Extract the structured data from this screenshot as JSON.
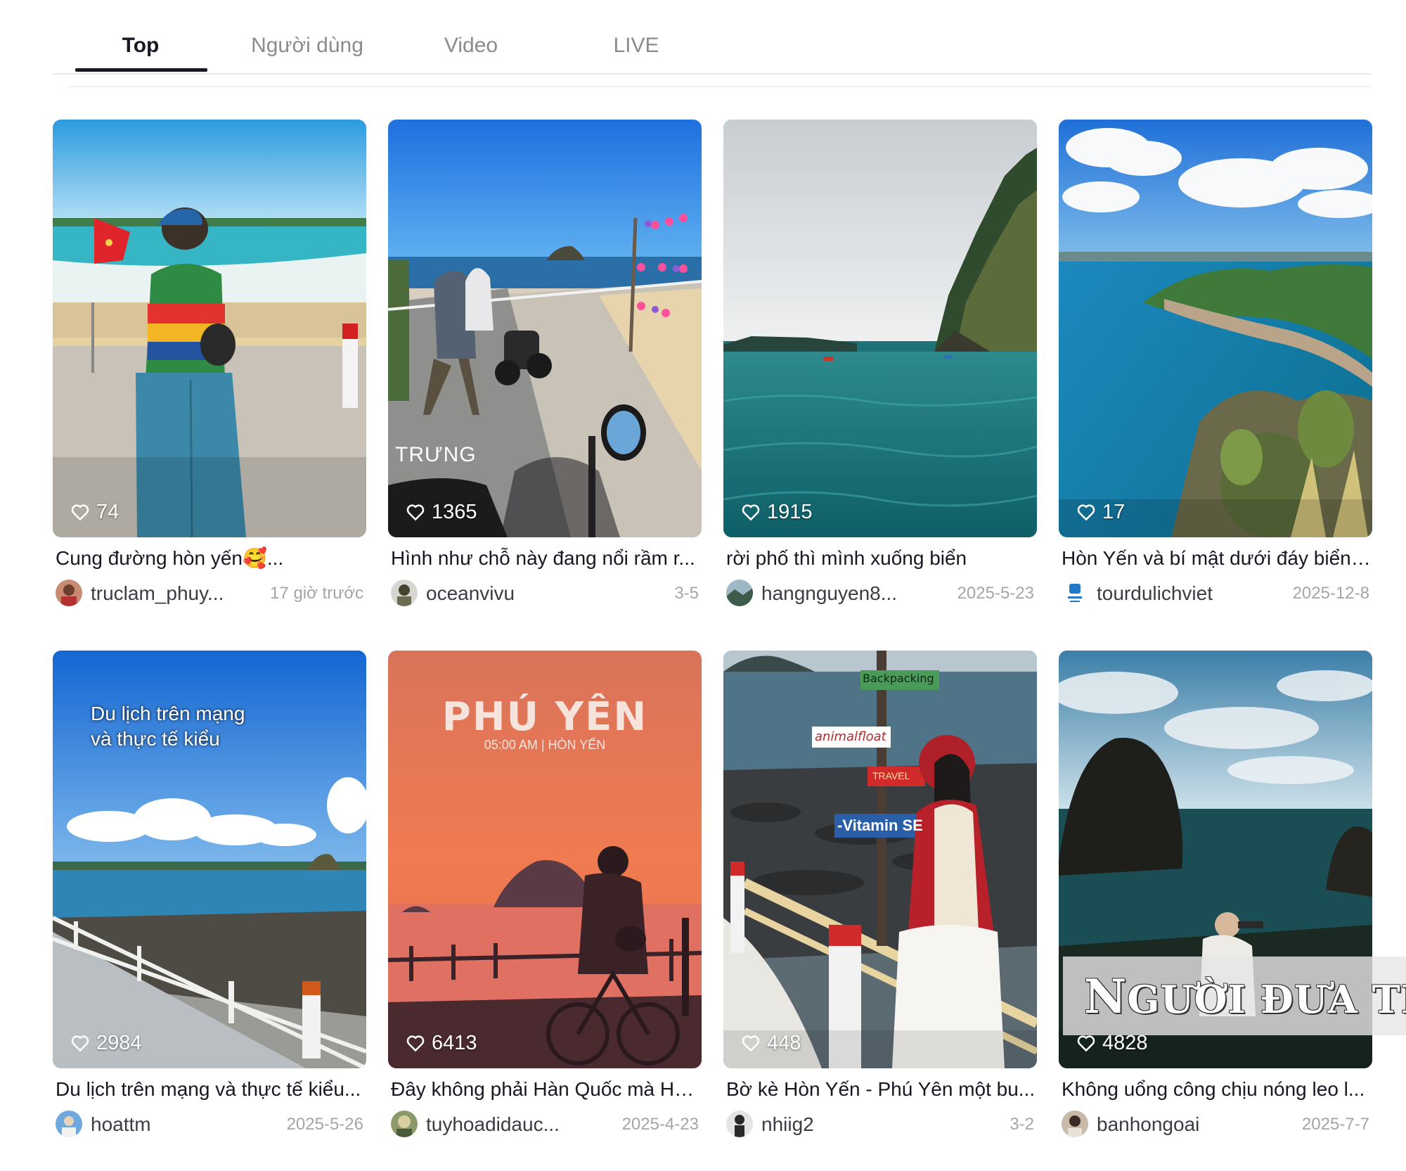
{
  "tabs": [
    {
      "label": "Top",
      "active": true
    },
    {
      "label": "Người dùng",
      "active": false
    },
    {
      "label": "Video",
      "active": false
    },
    {
      "label": "LIVE",
      "active": false
    }
  ],
  "videos": [
    {
      "likes": "74",
      "caption": "Cung đường hòn yến🥰...",
      "author": "truclam_phuy...",
      "date": "17 giờ trước"
    },
    {
      "likes": "1365",
      "caption": "Hình như chỗ này đang nổi rầm r...",
      "author": "oceanvivu",
      "date": "3-5",
      "overlay": "TRƯNG"
    },
    {
      "likes": "1915",
      "caption": "rời phố thì mình xuống biển",
      "author": "hangnguyen8...",
      "date": "2025-5-23"
    },
    {
      "likes": "17",
      "caption": "Hòn Yến và bí mật dưới đáy biển ...",
      "author": "tourdulichviet",
      "date": "2025-12-8"
    },
    {
      "likes": "2984",
      "caption": "Du lịch trên mạng và thực tế kiểu...",
      "author": "hoattm",
      "date": "2025-5-26",
      "overlay_line1": "Du lịch trên mạng",
      "overlay_line2": "và thực tế kiểu"
    },
    {
      "likes": "6413",
      "caption": "Đây không phải Hàn Quốc mà Hò...",
      "author": "tuyhoadidauc...",
      "date": "2025-4-23",
      "overlay_title": "PHÚ YÊN",
      "overlay_sub": "05:00 AM | HÒN YẾN"
    },
    {
      "likes": "448",
      "caption": "Bờ kè Hòn Yến - Phú Yên một bu...",
      "author": "nhiig2",
      "date": "3-2",
      "sign1": "Backpacking",
      "sign2": "animalfloat",
      "sign3": "TRAVEL",
      "sign4": "-Vitamin SE"
    },
    {
      "likes": "4828",
      "caption": "Không uổng công chịu nóng leo l...",
      "author": "banhongoai",
      "date": "2025-7-7"
    }
  ],
  "watermark": {
    "letter": "N",
    "text": "GƯỜI ĐƯA TIN"
  },
  "colors": {
    "text": "#161823",
    "muted": "#8a8b91",
    "date": "#a4a5aa"
  }
}
